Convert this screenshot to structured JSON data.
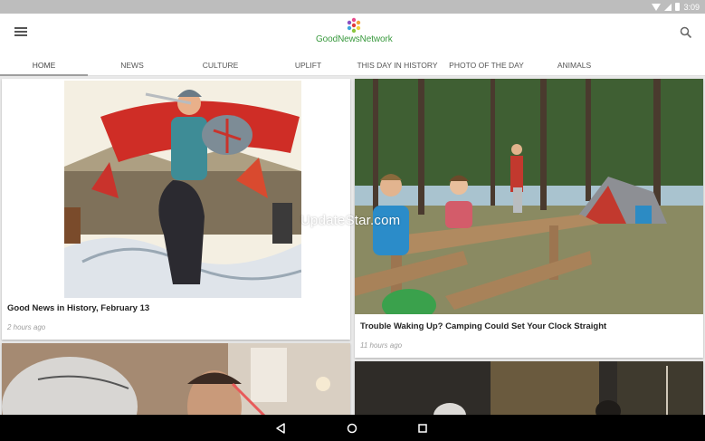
{
  "status": {
    "time": "3:09"
  },
  "brand": {
    "name": "GoodNewsNetwork"
  },
  "tabs": [
    {
      "label": "HOME",
      "active": true
    },
    {
      "label": "NEWS"
    },
    {
      "label": "CULTURE"
    },
    {
      "label": "UPLIFT"
    },
    {
      "label": "THIS DAY IN HISTORY"
    },
    {
      "label": "PHOTO OF THE DAY"
    },
    {
      "label": "ANIMALS"
    }
  ],
  "articles": [
    {
      "title": "Good News in History, February 13",
      "time": "2 hours ago"
    },
    {
      "title": "Trouble Waking Up? Camping Could Set Your Clock Straight",
      "time": "11 hours ago"
    }
  ],
  "watermark": "UpdateStar.com",
  "icons": {
    "menu": "hamburger-menu-icon",
    "search": "search-icon",
    "back": "back-icon",
    "home": "home-icon",
    "recents": "recents-icon"
  },
  "colors": {
    "brand_green": "#3a9a3f",
    "status_bar": "#bdbdbd",
    "nav_bar": "#000000"
  }
}
